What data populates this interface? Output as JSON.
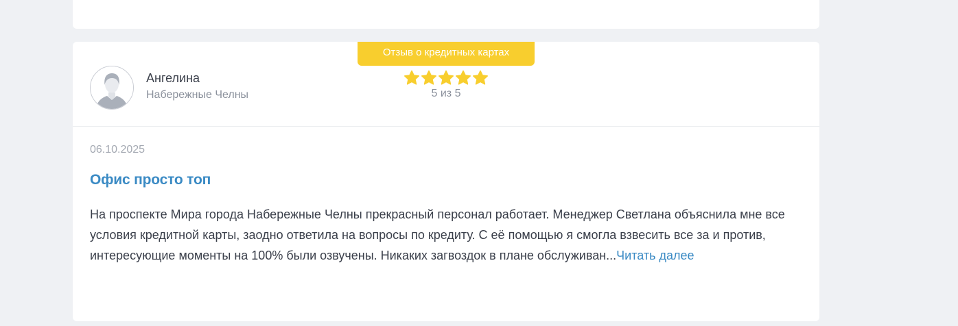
{
  "review": {
    "category_badge": "Отзыв о кредитных картах",
    "author": {
      "name": "Ангелина",
      "city": "Набережные Челны",
      "avatar_icon": "user-silhouette-icon"
    },
    "rating": {
      "value": 5,
      "max": 5,
      "label": "5 из 5",
      "star_color": "#f8ce2e"
    },
    "date": "06.10.2025",
    "title": "Офис просто топ",
    "text": "На проспекте Мира города Набережные Челны прекрасный персонал работает. Менеджер Светлана объяснила мне все условия кредитной карты, заодно ответила на вопросы по кредиту. С её помощью я смогла взвесить все за и против, интересующие моменты на 100% были озвучены. Никаких загвоздок в плане обслуживан...",
    "read_more_label": "Читать далее"
  },
  "colors": {
    "accent": "#3a8ac4",
    "badge": "#f8ce2e",
    "background": "#eff1f4"
  }
}
